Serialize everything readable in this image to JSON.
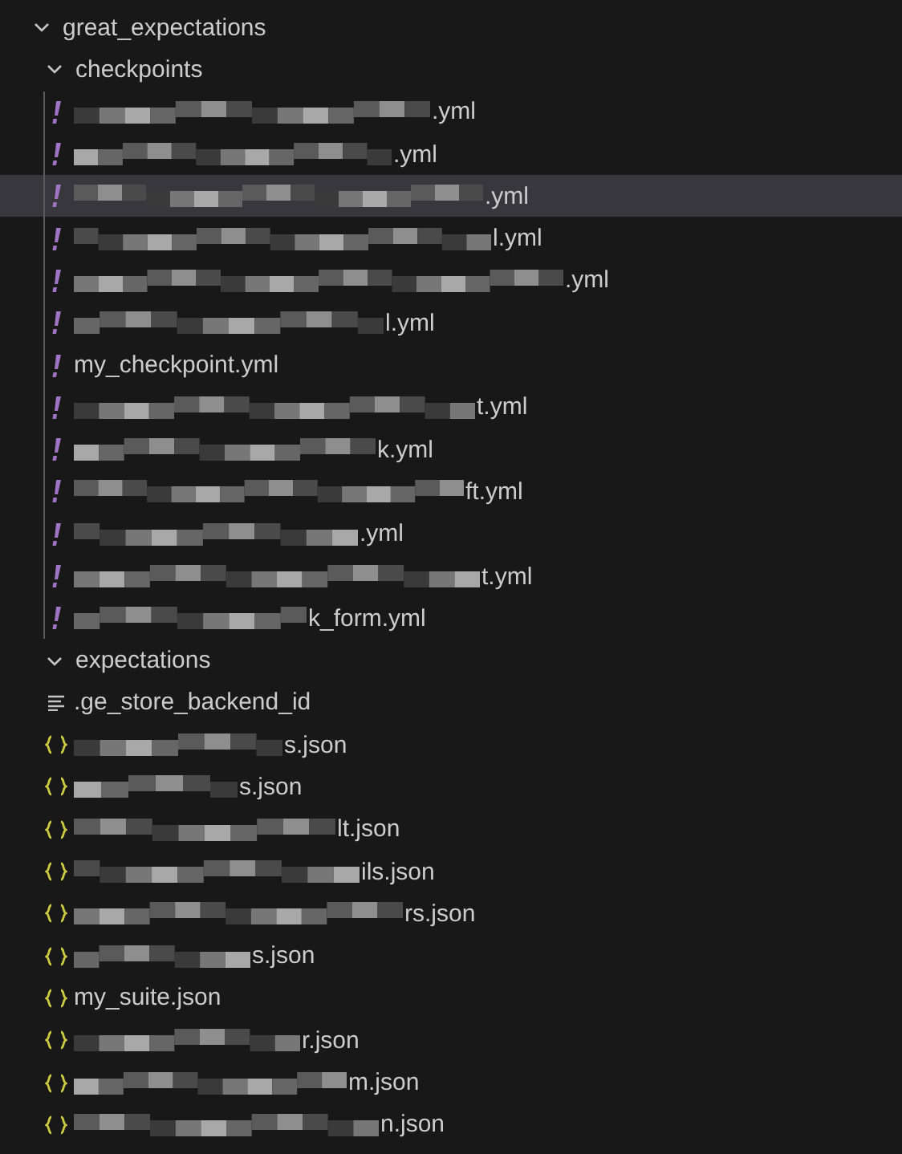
{
  "tree": {
    "label": "great_expectations",
    "expanded": true,
    "children": [
      {
        "label": "checkpoints",
        "expanded": true,
        "children": [
          {
            "kind": "yaml",
            "label": ".yml",
            "redacted": true,
            "selected": false
          },
          {
            "kind": "yaml",
            "label": ".yml",
            "redacted": true,
            "selected": false
          },
          {
            "kind": "yaml",
            "label": ".yml",
            "redacted": true,
            "selected": true
          },
          {
            "kind": "yaml",
            "label": "l.yml",
            "redacted": true,
            "selected": false
          },
          {
            "kind": "yaml",
            "label": ".yml",
            "redacted": true,
            "selected": false
          },
          {
            "kind": "yaml",
            "label": "l.yml",
            "redacted": true,
            "selected": false
          },
          {
            "kind": "yaml",
            "label": "my_checkpoint.yml",
            "redacted": false,
            "selected": false
          },
          {
            "kind": "yaml",
            "label": "t.yml",
            "redacted": true,
            "selected": false
          },
          {
            "kind": "yaml",
            "label": "k.yml",
            "redacted": true,
            "selected": false
          },
          {
            "kind": "yaml",
            "label": "ft.yml",
            "redacted": true,
            "selected": false
          },
          {
            "kind": "yaml",
            "label": ".yml",
            "redacted": true,
            "selected": false
          },
          {
            "kind": "yaml",
            "label": "t.yml",
            "redacted": true,
            "selected": false
          },
          {
            "kind": "yaml",
            "label": "k_form.yml",
            "redacted": true,
            "selected": false
          }
        ]
      },
      {
        "label": "expectations",
        "expanded": true,
        "children": [
          {
            "kind": "text",
            "label": ".ge_store_backend_id",
            "redacted": false,
            "selected": false
          },
          {
            "kind": "json",
            "label": "s.json",
            "redacted": true,
            "selected": false
          },
          {
            "kind": "json",
            "label": "s.json",
            "redacted": true,
            "selected": false
          },
          {
            "kind": "json",
            "label": "lt.json",
            "redacted": true,
            "selected": false
          },
          {
            "kind": "json",
            "label": "ils.json",
            "redacted": true,
            "selected": false
          },
          {
            "kind": "json",
            "label": "rs.json",
            "redacted": true,
            "selected": false
          },
          {
            "kind": "json",
            "label": "s.json",
            "redacted": true,
            "selected": false
          },
          {
            "kind": "json",
            "label": "my_suite.json",
            "redacted": false,
            "selected": false
          },
          {
            "kind": "json",
            "label": "r.json",
            "redacted": true,
            "selected": false
          },
          {
            "kind": "json",
            "label": "m.json",
            "redacted": true,
            "selected": false
          },
          {
            "kind": "json",
            "label": "n.json",
            "redacted": true,
            "selected": false
          }
        ]
      }
    ]
  }
}
